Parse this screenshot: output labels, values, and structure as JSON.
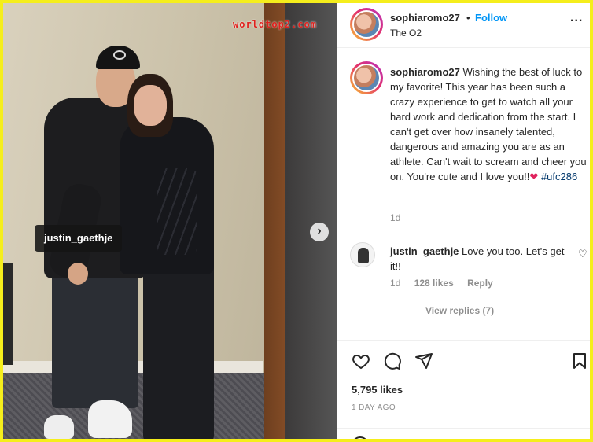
{
  "watermark": "worldtop2.com",
  "photo": {
    "tag_label": "justin_gaethje",
    "next_icon": "chevron-right-icon"
  },
  "header": {
    "username": "sophiaromo27",
    "separator": "•",
    "follow_label": "Follow",
    "location": "The O2",
    "more_icon": "ellipsis-icon",
    "more_glyph": "..."
  },
  "caption": {
    "username": "sophiaromo27",
    "text": "Wishing the best of luck to my favorite! This year has been such a crazy experience to get to watch all your hard work and dedication from the start. I can't get over how insanely talented, dangerous and amazing you are as an athlete. Can't wait to scream and cheer you on. You're cute and I love you!!",
    "heart": "❤",
    "hashtag": "#ufc286",
    "time": "1d"
  },
  "reply": {
    "username": "justin_gaethje",
    "text": "Love you too. Let's get it!!",
    "time": "1d",
    "likes": "128 likes",
    "reply_label": "Reply",
    "heart_glyph": "♡"
  },
  "view_replies": "View replies (7)",
  "likes": "5,795 likes",
  "post_time": "1 DAY AGO",
  "icons": {
    "like": "heart-icon",
    "comment": "comment-icon",
    "share": "share-icon",
    "save": "bookmark-icon"
  }
}
